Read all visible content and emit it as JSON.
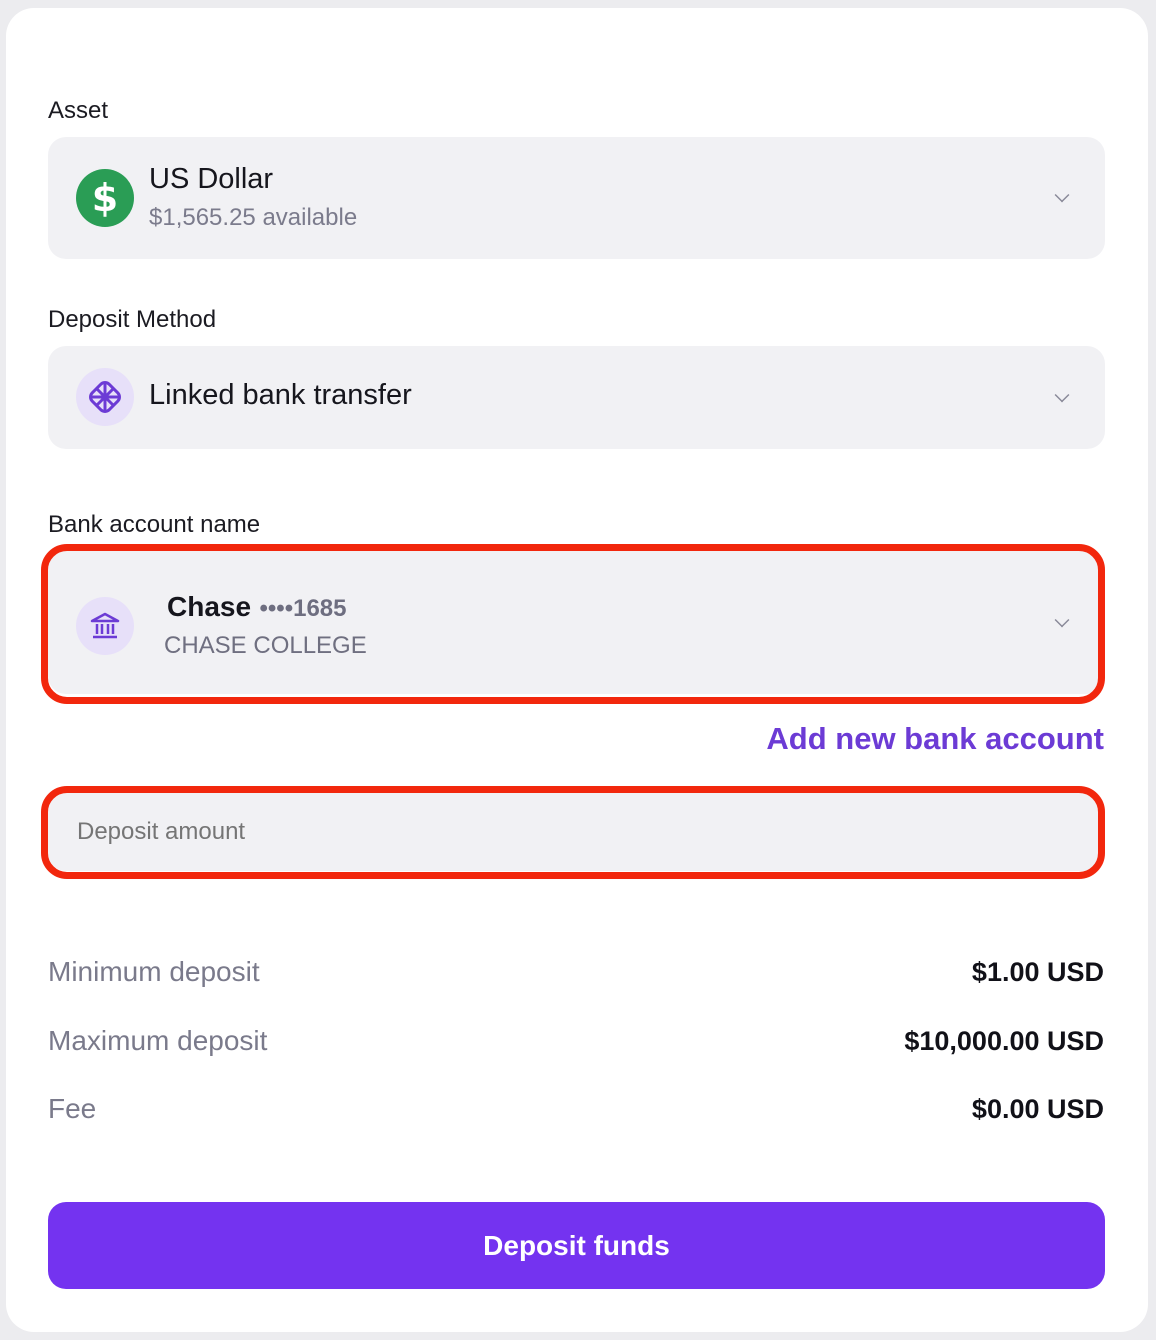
{
  "asset": {
    "label": "Asset",
    "name": "US Dollar",
    "available": "$1,565.25 available",
    "icon": "dollar-icon",
    "icon_color": "#2a9d55"
  },
  "deposit_method": {
    "label": "Deposit Method",
    "value": "Linked bank transfer",
    "icon": "plaid-icon"
  },
  "bank_account": {
    "label": "Bank account name",
    "bank_name": "Chase",
    "masked_number": "••••1685",
    "account_type": "CHASE COLLEGE",
    "icon": "bank-icon"
  },
  "add_bank_link": "Add new bank account",
  "deposit_amount": {
    "placeholder": "Deposit amount",
    "value": ""
  },
  "limits": [
    {
      "label": "Minimum deposit",
      "value": "$1.00 USD"
    },
    {
      "label": "Maximum deposit",
      "value": "$10,000.00 USD"
    },
    {
      "label": "Fee",
      "value": "$0.00 USD"
    }
  ],
  "submit_button": "Deposit funds",
  "colors": {
    "accent": "#7433f0",
    "link": "#6c3bd5",
    "highlight": "#f2270d",
    "field_bg": "#f1f1f4",
    "icon_bg": "#e7e0f9"
  }
}
